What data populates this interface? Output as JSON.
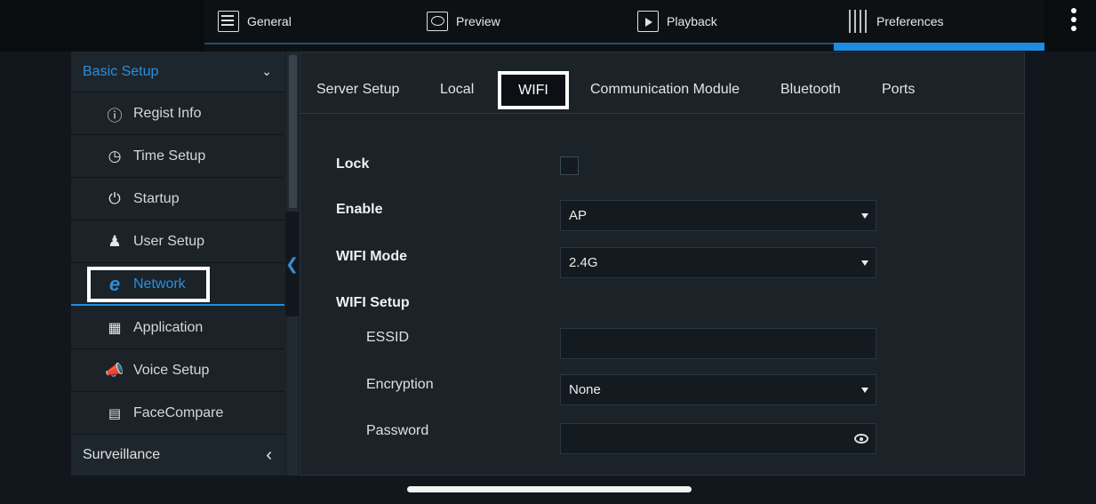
{
  "topnav": {
    "tabs": [
      {
        "label": "General",
        "icon": "general-grid-icon"
      },
      {
        "label": "Preview",
        "icon": "preview-eye-icon"
      },
      {
        "label": "Playback",
        "icon": "playback-icon"
      },
      {
        "label": "Preferences",
        "icon": "preferences-sliders-icon"
      }
    ],
    "active": "Preferences"
  },
  "sidebar": {
    "section_basic": "Basic Setup",
    "section_surveillance": "Surveillance",
    "items": [
      {
        "label": "Regist Info",
        "icon": "info-icon"
      },
      {
        "label": "Time Setup",
        "icon": "clock-icon"
      },
      {
        "label": "Startup",
        "icon": "power-icon"
      },
      {
        "label": "User Setup",
        "icon": "user-icon"
      },
      {
        "label": "Network",
        "icon": "network-ie-icon"
      },
      {
        "label": "Application",
        "icon": "qr-icon"
      },
      {
        "label": "Voice Setup",
        "icon": "megaphone-icon"
      },
      {
        "label": "FaceCompare",
        "icon": "id-card-icon"
      }
    ],
    "active": "Network"
  },
  "subtabs": [
    "Server Setup",
    "Local",
    "WIFI",
    "Communication Module",
    "Bluetooth",
    "Ports"
  ],
  "form": {
    "lock_label": "Lock",
    "enable_label": "Enable",
    "enable_value": "AP",
    "mode_label": "WIFI Mode",
    "mode_value": "2.4G",
    "setup_label": "WIFI Setup",
    "essid_label": "ESSID",
    "essid_value": "",
    "encryption_label": "Encryption",
    "encryption_value": "None",
    "password_label": "Password",
    "password_value": ""
  },
  "colors": {
    "accent": "#1c8de3",
    "background": "#11171d",
    "panel": "#1b2228"
  }
}
